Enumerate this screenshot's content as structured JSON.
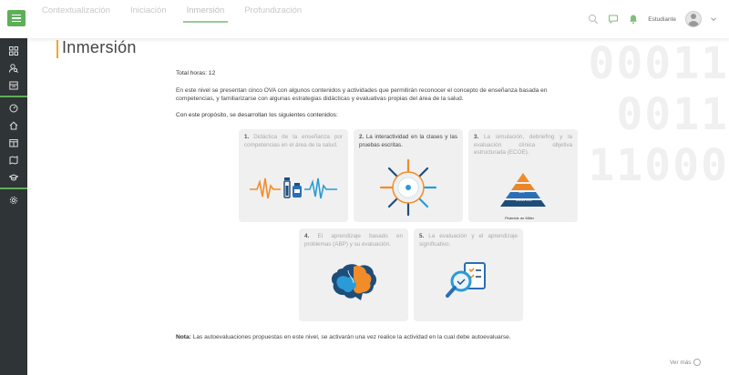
{
  "nav": {
    "tabs": [
      {
        "label": "Contextualización",
        "active": false
      },
      {
        "label": "Iniciación",
        "active": false
      },
      {
        "label": "Inmersión",
        "active": true
      },
      {
        "label": "Profundización",
        "active": false
      }
    ],
    "user_label": "Estudiante"
  },
  "sidebar": {
    "icons": [
      "grid-icon",
      "user-search-icon",
      "book-icon",
      "dashboard-icon",
      "home-icon",
      "calendar-icon",
      "map-icon",
      "graduation-icon",
      "settings-icon"
    ]
  },
  "page": {
    "title": "Inmersión",
    "total_hours": "Total horas: 12",
    "intro": "En este nivel se presentan cinco OVA con algunos contenidos y actividades que permitirán reconocer el concepto de enseñanza basada en competencias, y familiarizarse con algunas estrategias didácticas y evaluativas propias del área de la salud.",
    "purpose": "Con este propósito, se desarrollan los siguientes contenidos:",
    "cards": [
      {
        "num": "1.",
        "text": "Didáctica de la enseñanza por competencias en el área de la salud."
      },
      {
        "num": "2.",
        "text": "La interactividad en la clases y las pruebas escritas."
      },
      {
        "num": "3.",
        "text": "La simulación, debriefing y la evaluación clínica objetiva estructurada (ECOE)."
      },
      {
        "num": "4.",
        "text": "El aprendizaje basado en problemas (ABP) y su evaluación."
      },
      {
        "num": "5.",
        "text": "La evaluación y el aprendizaje significativo."
      }
    ],
    "pyramid_caption": "Pirámide de Miller",
    "pyramid_levels": [
      "Hace",
      "Muestra cómo",
      "Sabe cómo",
      "Sabe"
    ],
    "note_label": "Nota:",
    "note_text": " Las autoevaluaciones propuestas en este nivel, se activarán una vez realice la actividad en la cual debe autoevaluarse.",
    "see_more": "Ver más"
  },
  "colors": {
    "accent": "#5fae5a",
    "title_bar": "#f5a623",
    "sidebar_bg": "#2f3436",
    "card_bg": "#f0f0f0"
  }
}
